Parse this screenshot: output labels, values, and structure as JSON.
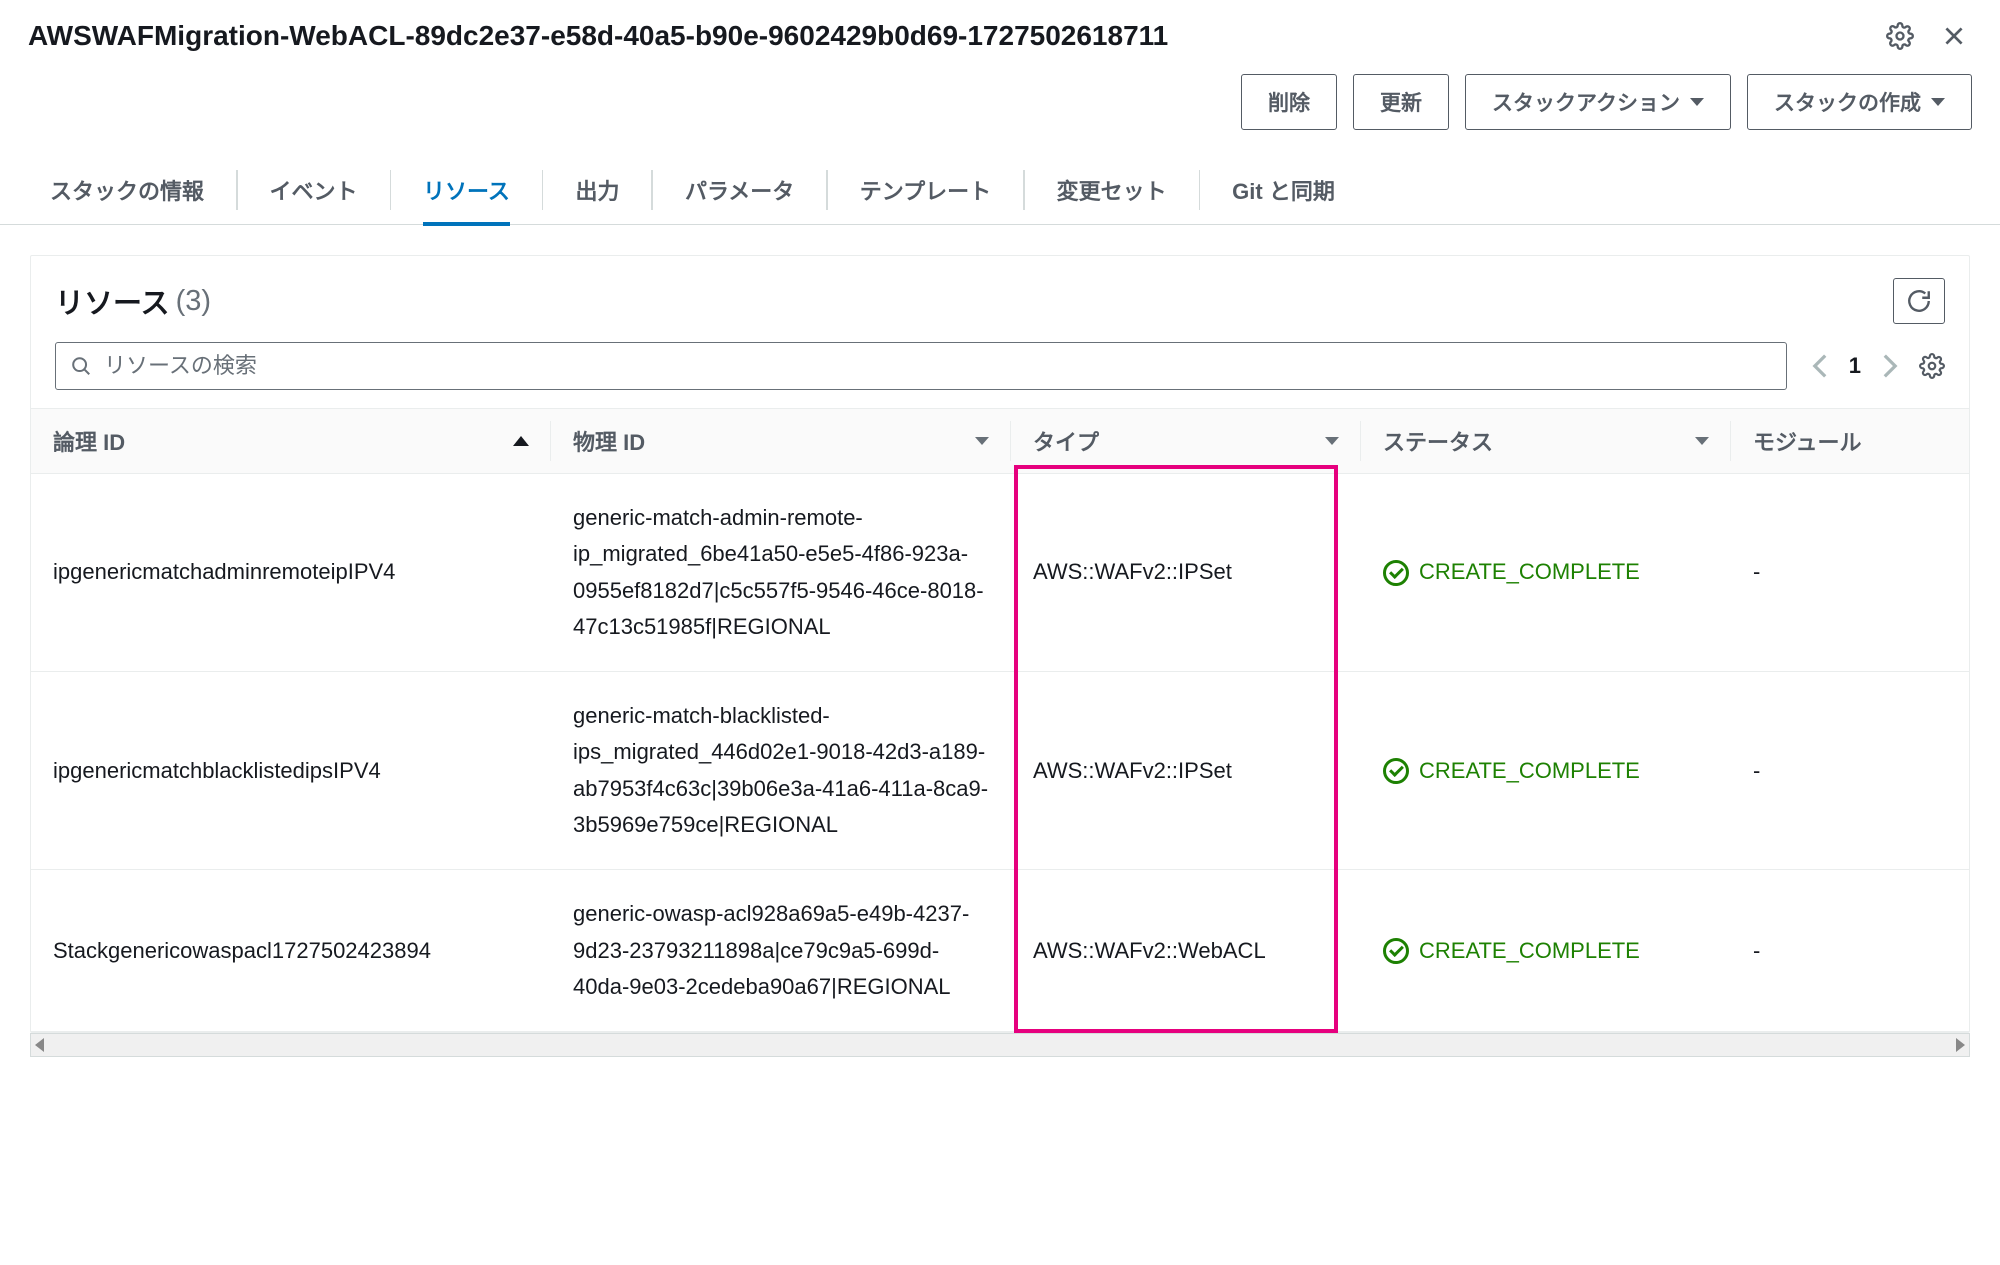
{
  "header": {
    "title": "AWSWAFMigration-WebACL-89dc2e37-e58d-40a5-b90e-9602429b0d69-1727502618711"
  },
  "actions": {
    "delete": "削除",
    "update": "更新",
    "stack_actions": "スタックアクション",
    "create_stack": "スタックの作成"
  },
  "tabs": {
    "info": "スタックの情報",
    "events": "イベント",
    "resources": "リソース",
    "outputs": "出力",
    "parameters": "パラメータ",
    "template": "テンプレート",
    "changesets": "変更セット",
    "gitsync": "Git と同期"
  },
  "panel": {
    "title": "リソース",
    "count": "(3)",
    "search_placeholder": "リソースの検索",
    "page": "1"
  },
  "columns": {
    "logical_id": "論理 ID",
    "physical_id": "物理 ID",
    "type": "タイプ",
    "status": "ステータス",
    "module": "モジュール"
  },
  "rows": [
    {
      "logical_id": "ipgenericmatchadminremoteipIPV4",
      "physical_id": "generic-match-admin-remote-ip_migrated_6be41a50-e5e5-4f86-923a-0955ef8182d7|c5c557f5-9546-46ce-8018-47c13c51985f|REGIONAL",
      "type": "AWS::WAFv2::IPSet",
      "status": "CREATE_COMPLETE",
      "module": "-"
    },
    {
      "logical_id": "ipgenericmatchblacklistedipsIPV4",
      "physical_id": "generic-match-blacklisted-ips_migrated_446d02e1-9018-42d3-a189-ab7953f4c63c|39b06e3a-41a6-411a-8ca9-3b5969e759ce|REGIONAL",
      "type": "AWS::WAFv2::IPSet",
      "status": "CREATE_COMPLETE",
      "module": "-"
    },
    {
      "logical_id": "Stackgenericowaspacl1727502423894",
      "physical_id": "generic-owasp-acl928a69a5-e49b-4237-9d23-23793211898a|ce79c9a5-699d-40da-9e03-2cedeba90a67|REGIONAL",
      "type": "AWS::WAFv2::WebACL",
      "status": "CREATE_COMPLETE",
      "module": "-"
    }
  ]
}
